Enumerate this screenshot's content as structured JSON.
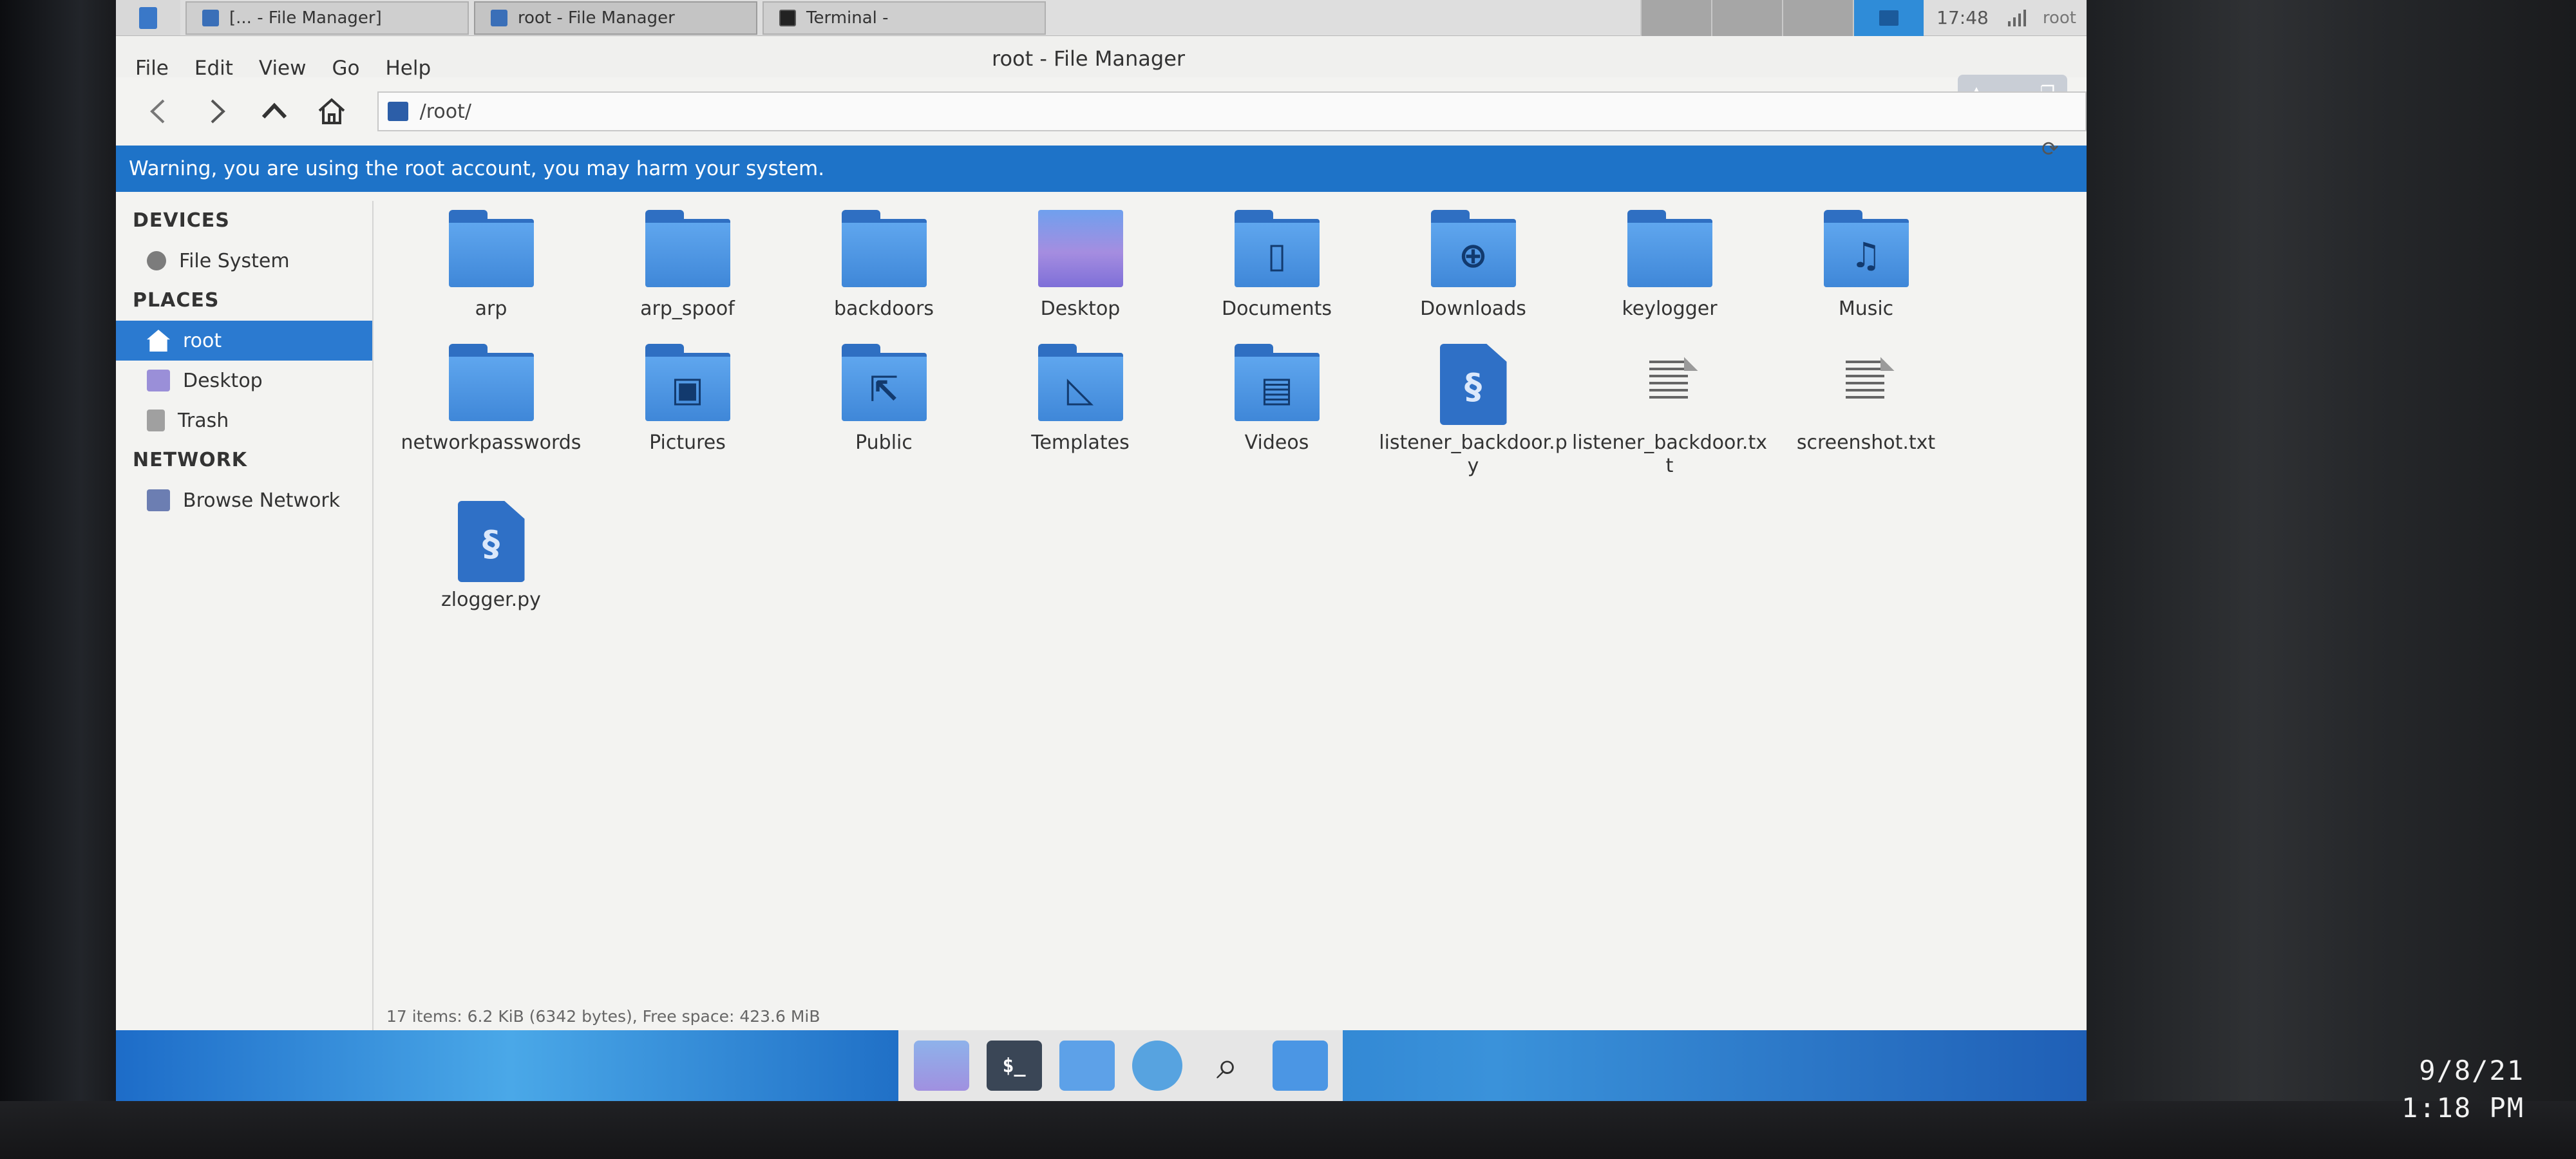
{
  "top_panel": {
    "tasks": [
      {
        "label": "[... - File Manager]"
      },
      {
        "label": "root - File Manager"
      },
      {
        "label": "Terminal -"
      }
    ],
    "clock": "17:48",
    "user": "root"
  },
  "window": {
    "title": "root - File Manager",
    "menu": [
      "File",
      "Edit",
      "View",
      "Go",
      "Help"
    ],
    "path": "/root/",
    "warning": "Warning, you are using the root account, you may harm your system."
  },
  "sidebar": {
    "devices_title": "DEVICES",
    "devices": [
      {
        "label": "File System",
        "icon": "disk-icon"
      }
    ],
    "places_title": "PLACES",
    "places": [
      {
        "label": "root",
        "icon": "home-icon",
        "selected": true
      },
      {
        "label": "Desktop",
        "icon": "desktop-icon"
      },
      {
        "label": "Trash",
        "icon": "trash-icon"
      }
    ],
    "network_title": "NETWORK",
    "network": [
      {
        "label": "Browse Network",
        "icon": "network-icon"
      }
    ]
  },
  "files": [
    {
      "name": "arp",
      "kind": "folder"
    },
    {
      "name": "arp_spoof",
      "kind": "folder"
    },
    {
      "name": "backdoors",
      "kind": "folder"
    },
    {
      "name": "Desktop",
      "kind": "desktop"
    },
    {
      "name": "Documents",
      "kind": "folder",
      "glyph": "document"
    },
    {
      "name": "Downloads",
      "kind": "folder",
      "glyph": "download"
    },
    {
      "name": "keylogger",
      "kind": "folder"
    },
    {
      "name": "Music",
      "kind": "folder",
      "glyph": "music"
    },
    {
      "name": "networkpasswords",
      "kind": "folder"
    },
    {
      "name": "Pictures",
      "kind": "folder",
      "glyph": "pictures"
    },
    {
      "name": "Public",
      "kind": "folder",
      "glyph": "share"
    },
    {
      "name": "Templates",
      "kind": "folder",
      "glyph": "template"
    },
    {
      "name": "Videos",
      "kind": "folder",
      "glyph": "film"
    },
    {
      "name": "listener_backdoor.py",
      "kind": "python"
    },
    {
      "name": "listener_backdoor.txt",
      "kind": "text"
    },
    {
      "name": "screenshot.txt",
      "kind": "text"
    },
    {
      "name": "zlogger.py",
      "kind": "python"
    }
  ],
  "status": "17 items: 6.2 KiB (6342 bytes), Free space: 423.6 MiB",
  "dock": [
    "files-icon",
    "terminal-icon",
    "folder-icon",
    "browser-icon",
    "search-icon",
    "folder-icon"
  ],
  "timestamp": {
    "date": "9/8/21",
    "time": "1:18 PM"
  },
  "colors": {
    "accent": "#2b7ad0",
    "warning_bar": "#1e73c8",
    "folder": "#4a92df"
  }
}
